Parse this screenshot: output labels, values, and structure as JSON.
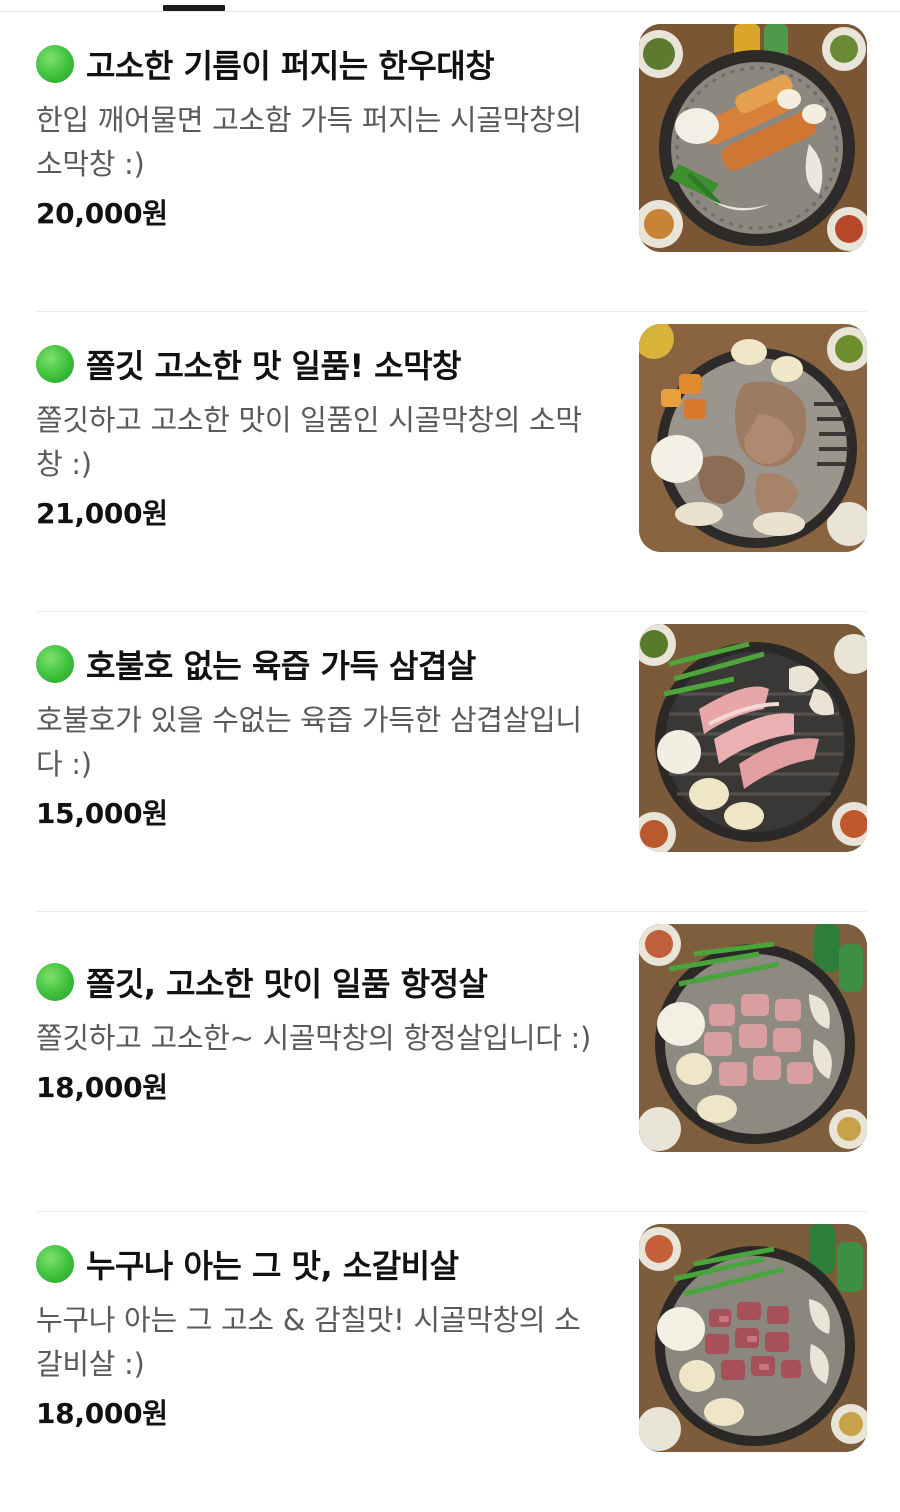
{
  "menu": {
    "items": [
      {
        "title": "고소한 기름이 퍼지는 한우대창",
        "description": "한입 깨어물면 고소함 가득 퍼지는 시골막창의 소막창 :)",
        "price": "20,000원",
        "photo": "grilled-beef-daechang"
      },
      {
        "title": "쫄깃 고소한 맛 일품! 소막창",
        "description": "쫄깃하고 고소한 맛이 일품인 시골막창의 소막창 :)",
        "price": "21,000원",
        "photo": "grilled-beef-makchang"
      },
      {
        "title": "호불호 없는 육즙 가득 삼겹살",
        "description": "호불호가 있을 수없는 육즙 가득한 삼겹살입니다 :)",
        "price": "15,000원",
        "photo": "grilled-pork-belly"
      },
      {
        "title": "쫄깃, 고소한 맛이 일품 항정살",
        "description": "쫄깃하고 고소한~ 시골막창의 항정살입니다 :)",
        "price": "18,000원",
        "photo": "grilled-pork-jowl"
      },
      {
        "title": "누구나 아는 그 맛, 소갈비살",
        "description": "누구나 아는 그 고소 & 감칠맛! 시골막창의 소갈비살 :)",
        "price": "18,000원",
        "photo": "grilled-beef-rib-meat"
      }
    ]
  },
  "colors": {
    "status_dot": "#3cbf3b",
    "title_text": "#111111",
    "description_text": "#5a5a5a",
    "divider": "#ebebeb"
  }
}
